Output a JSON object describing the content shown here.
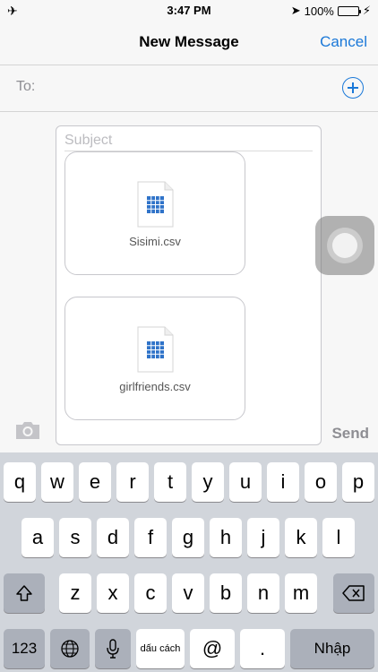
{
  "status": {
    "time": "3:47 PM",
    "battery": "100%"
  },
  "nav": {
    "title": "New Message",
    "cancel": "Cancel"
  },
  "recipient": {
    "label": "To:"
  },
  "message": {
    "subject_placeholder": "Subject",
    "attachments": [
      {
        "name": "Sisimi.csv"
      },
      {
        "name": "girlfriends.csv"
      }
    ],
    "send_label": "Send"
  },
  "keyboard": {
    "row1": [
      "q",
      "w",
      "e",
      "r",
      "t",
      "y",
      "u",
      "i",
      "o",
      "p"
    ],
    "row2": [
      "a",
      "s",
      "d",
      "f",
      "g",
      "h",
      "j",
      "k",
      "l"
    ],
    "row3": [
      "z",
      "x",
      "c",
      "v",
      "b",
      "n",
      "m"
    ],
    "numbers": "123",
    "space": "dấu cách",
    "at": "@",
    "period": ".",
    "return": "Nhập"
  },
  "colors": {
    "accent": "#1a78d8",
    "battery": "#4cd964",
    "keyboard_bg": "#d1d5db"
  }
}
